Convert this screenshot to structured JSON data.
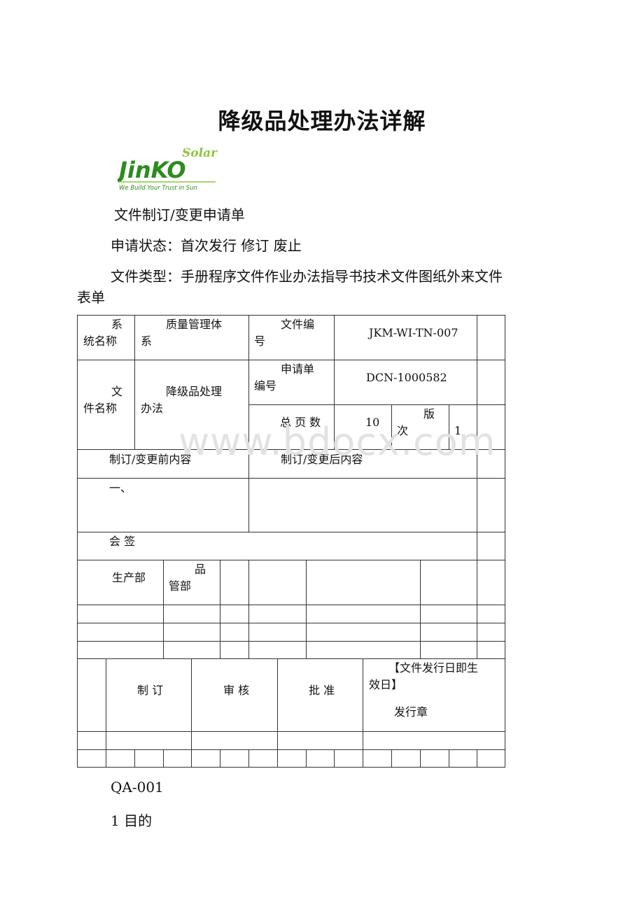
{
  "document": {
    "title": "降级品处理办法详解",
    "logo": {
      "brand": "JinKO",
      "brand_sub": "Solar",
      "tagline": "We Build Your Trust in Sun",
      "colors": {
        "primary": "#2e8b1f",
        "accent": "#8cc63f"
      }
    },
    "form_name": "文件制订/变更申请单",
    "status_line": "申请状态：首次发行 修订 废止",
    "type_line_1": "文件类型：手册程序文件作业办法指导书技术文件图纸外来文件",
    "type_line_2": "表单",
    "watermark": "www.bdocx.com"
  },
  "table": {
    "system_name_label_1": "系",
    "system_name_label_2": "统名称",
    "system_name_value_1": "质量管理体",
    "system_name_value_2": "系",
    "doc_no_label_1": "文件编",
    "doc_no_label_2": "号",
    "doc_no_value": "JKM-WI-TN-007",
    "file_name_label_1": "文",
    "file_name_label_2": "件名称",
    "file_name_value_1": "降级品处理",
    "file_name_value_2": "办法",
    "request_no_label_1": "申请单",
    "request_no_label_2": "编号",
    "request_no_value": "DCN-1000582",
    "total_pages_label": "总 页 数",
    "total_pages_value": "10",
    "version_label_1": "版",
    "version_label_2": "次",
    "version_value": "1",
    "before_header": "制订/变更前内容",
    "after_header": "制订/变更后内容",
    "before_content": "一、",
    "after_content": "",
    "countersign_label": "会 签",
    "dept_production": "生产部",
    "dept_quality_1": "品",
    "dept_quality_2": "管部",
    "draft_label": "制 订",
    "review_label": "审 核",
    "approve_label": "批 准",
    "effective_note_1": "【文件发行日即生",
    "effective_note_2": "效日】",
    "issue_seal_label": "发行章"
  },
  "footer": {
    "code": "QA-001",
    "section_1": "1 目的"
  }
}
